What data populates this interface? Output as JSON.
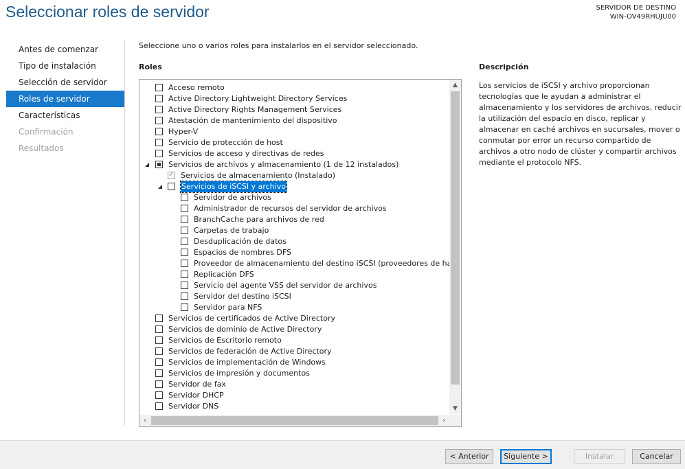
{
  "header": {
    "title": "Seleccionar roles de servidor",
    "dest_label": "SERVIDOR DE DESTINO",
    "dest_name": "WIN-OV49RHUJU00"
  },
  "nav": {
    "items": [
      {
        "label": "Antes de comenzar"
      },
      {
        "label": "Tipo de instalación"
      },
      {
        "label": "Selección de servidor"
      },
      {
        "label": "Roles de servidor"
      },
      {
        "label": "Características"
      },
      {
        "label": "Confirmación"
      },
      {
        "label": "Resultados"
      }
    ]
  },
  "main": {
    "instructions": "Seleccione uno o varios roles para instalarlos en el servidor seleccionado.",
    "roles_label": "Roles",
    "roles": [
      {
        "label": "Acceso remoto",
        "level": 0,
        "state": "unchecked"
      },
      {
        "label": "Active Directory Lightweight Directory Services",
        "level": 0,
        "state": "unchecked"
      },
      {
        "label": "Active Directory Rights Management Services",
        "level": 0,
        "state": "unchecked"
      },
      {
        "label": "Atestación de mantenimiento del dispositivo",
        "level": 0,
        "state": "unchecked"
      },
      {
        "label": "Hyper-V",
        "level": 0,
        "state": "unchecked"
      },
      {
        "label": "Servicio de protección de host",
        "level": 0,
        "state": "unchecked"
      },
      {
        "label": "Servicios de acceso y directivas de redes",
        "level": 0,
        "state": "unchecked"
      },
      {
        "label": "Servicios de archivos y almacenamiento (1 de 12 instalados)",
        "level": 0,
        "state": "partial",
        "expanded": true
      },
      {
        "label": "Servicios de almacenamiento (Instalado)",
        "level": 1,
        "state": "checked"
      },
      {
        "label": "Servicios de iSCSI y archivo",
        "level": 1,
        "state": "unchecked",
        "expanded": true,
        "selected": true
      },
      {
        "label": "Servidor de archivos",
        "level": 2,
        "state": "unchecked"
      },
      {
        "label": "Administrador de recursos del servidor de archivos",
        "level": 2,
        "state": "unchecked"
      },
      {
        "label": "BranchCache para archivos de red",
        "level": 2,
        "state": "unchecked"
      },
      {
        "label": "Carpetas de trabajo",
        "level": 2,
        "state": "unchecked"
      },
      {
        "label": "Desduplicación de datos",
        "level": 2,
        "state": "unchecked"
      },
      {
        "label": "Espacios de nombres DFS",
        "level": 2,
        "state": "unchecked"
      },
      {
        "label": "Proveedor de almacenamiento del destino iSCSI (proveedores de hard",
        "level": 2,
        "state": "unchecked"
      },
      {
        "label": "Replicación DFS",
        "level": 2,
        "state": "unchecked"
      },
      {
        "label": "Servicio del agente VSS del servidor de archivos",
        "level": 2,
        "state": "unchecked"
      },
      {
        "label": "Servidor del destino iSCSI",
        "level": 2,
        "state": "unchecked"
      },
      {
        "label": "Servidor para NFS",
        "level": 2,
        "state": "unchecked"
      },
      {
        "label": "Servicios de certificados de Active Directory",
        "level": 0,
        "state": "unchecked"
      },
      {
        "label": "Servicios de dominio de Active Directory",
        "level": 0,
        "state": "unchecked"
      },
      {
        "label": "Servicios de Escritorio remoto",
        "level": 0,
        "state": "unchecked"
      },
      {
        "label": "Servicios de federación de Active Directory",
        "level": 0,
        "state": "unchecked"
      },
      {
        "label": "Servicios de implementación de Windows",
        "level": 0,
        "state": "unchecked"
      },
      {
        "label": "Servicios de impresión y documentos",
        "level": 0,
        "state": "unchecked"
      },
      {
        "label": "Servidor de fax",
        "level": 0,
        "state": "unchecked"
      },
      {
        "label": "Servidor DHCP",
        "level": 0,
        "state": "unchecked"
      },
      {
        "label": "Servidor DNS",
        "level": 0,
        "state": "unchecked"
      }
    ]
  },
  "description": {
    "title": "Descripción",
    "text": "Los servicios de iSCSI y archivo proporcionan tecnologías que le ayudan a administrar el almacenamiento y los servidores de archivos, reducir la utilización del espacio en disco, replicar y almacenar en caché archivos en sucursales, mover o conmutar por error un recurso compartido de archivos a otro nodo de clúster y compartir archivos mediante el protocolo NFS."
  },
  "footer": {
    "previous": "< Anterior",
    "next": "Siguiente >",
    "install": "Instalar",
    "cancel": "Cancelar"
  },
  "colors": {
    "accent": "#1979ca",
    "title": "#1e5a8a",
    "selection": "#0078d7"
  }
}
